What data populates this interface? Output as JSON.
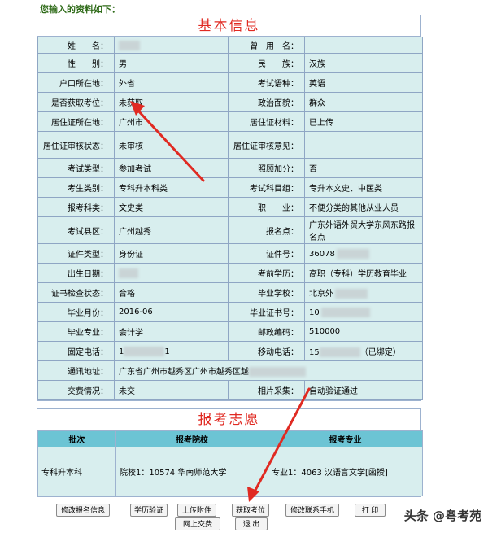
{
  "intro": "您输入的资料如下：",
  "basic": {
    "title": "基本信息",
    "rows": [
      [
        {
          "t": "k",
          "v": "姓　　名："
        },
        {
          "t": "blur",
          "w": 26
        },
        {
          "t": "k",
          "v": "曾　用　名："
        },
        {
          "t": "v",
          "v": ""
        }
      ],
      [
        {
          "t": "k",
          "v": "性　　别："
        },
        {
          "t": "v",
          "v": "男"
        },
        {
          "t": "k",
          "v": "民　　族："
        },
        {
          "t": "v",
          "v": "汉族"
        }
      ],
      [
        {
          "t": "k",
          "v": "户口所在地："
        },
        {
          "t": "v",
          "v": "外省"
        },
        {
          "t": "k",
          "v": "考试语种："
        },
        {
          "t": "v",
          "v": "英语"
        }
      ],
      [
        {
          "t": "k",
          "v": "是否获取考位："
        },
        {
          "t": "v",
          "v": "未获取"
        },
        {
          "t": "k",
          "v": "政治面貌："
        },
        {
          "t": "v",
          "v": "群众"
        }
      ],
      [
        {
          "t": "k",
          "v": "居住证所在地："
        },
        {
          "t": "v",
          "v": "广州市"
        },
        {
          "t": "k",
          "v": "居住证材料："
        },
        {
          "t": "v",
          "v": "已上传"
        }
      ],
      [
        {
          "t": "k",
          "v": "居住证审核状态："
        },
        {
          "t": "v",
          "v": "未审核"
        },
        {
          "t": "k",
          "v": "居住证审核意见："
        },
        {
          "t": "v",
          "v": ""
        }
      ],
      [
        {
          "t": "k",
          "v": "考试类型："
        },
        {
          "t": "v",
          "v": "参加考试"
        },
        {
          "t": "k",
          "v": "照顾加分："
        },
        {
          "t": "v",
          "v": "否"
        }
      ],
      [
        {
          "t": "k",
          "v": "考生类别："
        },
        {
          "t": "v",
          "v": "专科升本科类"
        },
        {
          "t": "k",
          "v": "考试科目组："
        },
        {
          "t": "v",
          "v": "专升本文史、中医类"
        }
      ],
      [
        {
          "t": "k",
          "v": "报考科类："
        },
        {
          "t": "v",
          "v": "文史类"
        },
        {
          "t": "k",
          "v": "职　　业："
        },
        {
          "t": "v",
          "v": "不便分类的其他从业人员"
        }
      ],
      [
        {
          "t": "k",
          "v": "考试县区："
        },
        {
          "t": "v",
          "v": "广州越秀"
        },
        {
          "t": "k",
          "v": "报名点："
        },
        {
          "t": "v",
          "v": "广东外语外贸大学东风东路报名点"
        }
      ],
      [
        {
          "t": "k",
          "v": "证件类型："
        },
        {
          "t": "v",
          "v": "身份证"
        },
        {
          "t": "k",
          "v": "证件号："
        },
        {
          "t": "vb",
          "v": "36078",
          "w": 40
        }
      ],
      [
        {
          "t": "k",
          "v": "出生日期："
        },
        {
          "t": "blur",
          "w": 24
        },
        {
          "t": "k",
          "v": "考前学历："
        },
        {
          "t": "v",
          "v": "高职（专科）学历教育毕业"
        }
      ],
      [
        {
          "t": "k",
          "v": "证书检查状态："
        },
        {
          "t": "v",
          "v": "合格"
        },
        {
          "t": "k",
          "v": "毕业学校："
        },
        {
          "t": "vb",
          "v": "北京外",
          "w": 40
        }
      ],
      [
        {
          "t": "k",
          "v": "毕业月份："
        },
        {
          "t": "v",
          "v": "2016-06"
        },
        {
          "t": "k",
          "v": "毕业证书号："
        },
        {
          "t": "vb",
          "v": "10",
          "w": 60
        }
      ],
      [
        {
          "t": "k",
          "v": "毕业专业："
        },
        {
          "t": "v",
          "v": "会计学"
        },
        {
          "t": "k",
          "v": "邮政编码："
        },
        {
          "t": "v",
          "v": "510000"
        }
      ],
      [
        {
          "t": "k",
          "v": "固定电话："
        },
        {
          "t": "bv",
          "v": "1",
          "w": 50,
          "s": "1"
        },
        {
          "t": "k",
          "v": "移动电话："
        },
        {
          "t": "bv",
          "v": "15",
          "w": 50,
          "s": "（已绑定）"
        }
      ],
      [
        {
          "t": "k",
          "v": "通讯地址："
        },
        {
          "t": "addr",
          "v": "广东省广州市越秀区广州市越秀区越",
          "w": 70
        }
      ],
      [
        {
          "t": "k",
          "v": "交费情况："
        },
        {
          "t": "v",
          "v": "未交"
        },
        {
          "t": "k",
          "v": "相片采集："
        },
        {
          "t": "v",
          "v": "自动验证通过"
        }
      ]
    ]
  },
  "wish": {
    "title": "报考志愿",
    "headers": [
      "批次",
      "报考院校",
      "报考专业"
    ],
    "row": {
      "batch": "专科升本科",
      "school": "院校1：10574  华南师范大学",
      "major": "专业1：4063 汉语言文学[函授]"
    }
  },
  "buttons": {
    "modify": "修改报名信息",
    "verify": "学历验证",
    "upload": "上传附件",
    "seat": "获取考位",
    "phone": "修改联系手机",
    "print": "打 印",
    "pay": "网上交费",
    "exit": "退 出"
  },
  "watermark": "头条 @粤考苑",
  "colors": {
    "accent_red": "#e02a22",
    "cell_bg": "#d8eeee",
    "header_bg": "#6cc4d4"
  }
}
